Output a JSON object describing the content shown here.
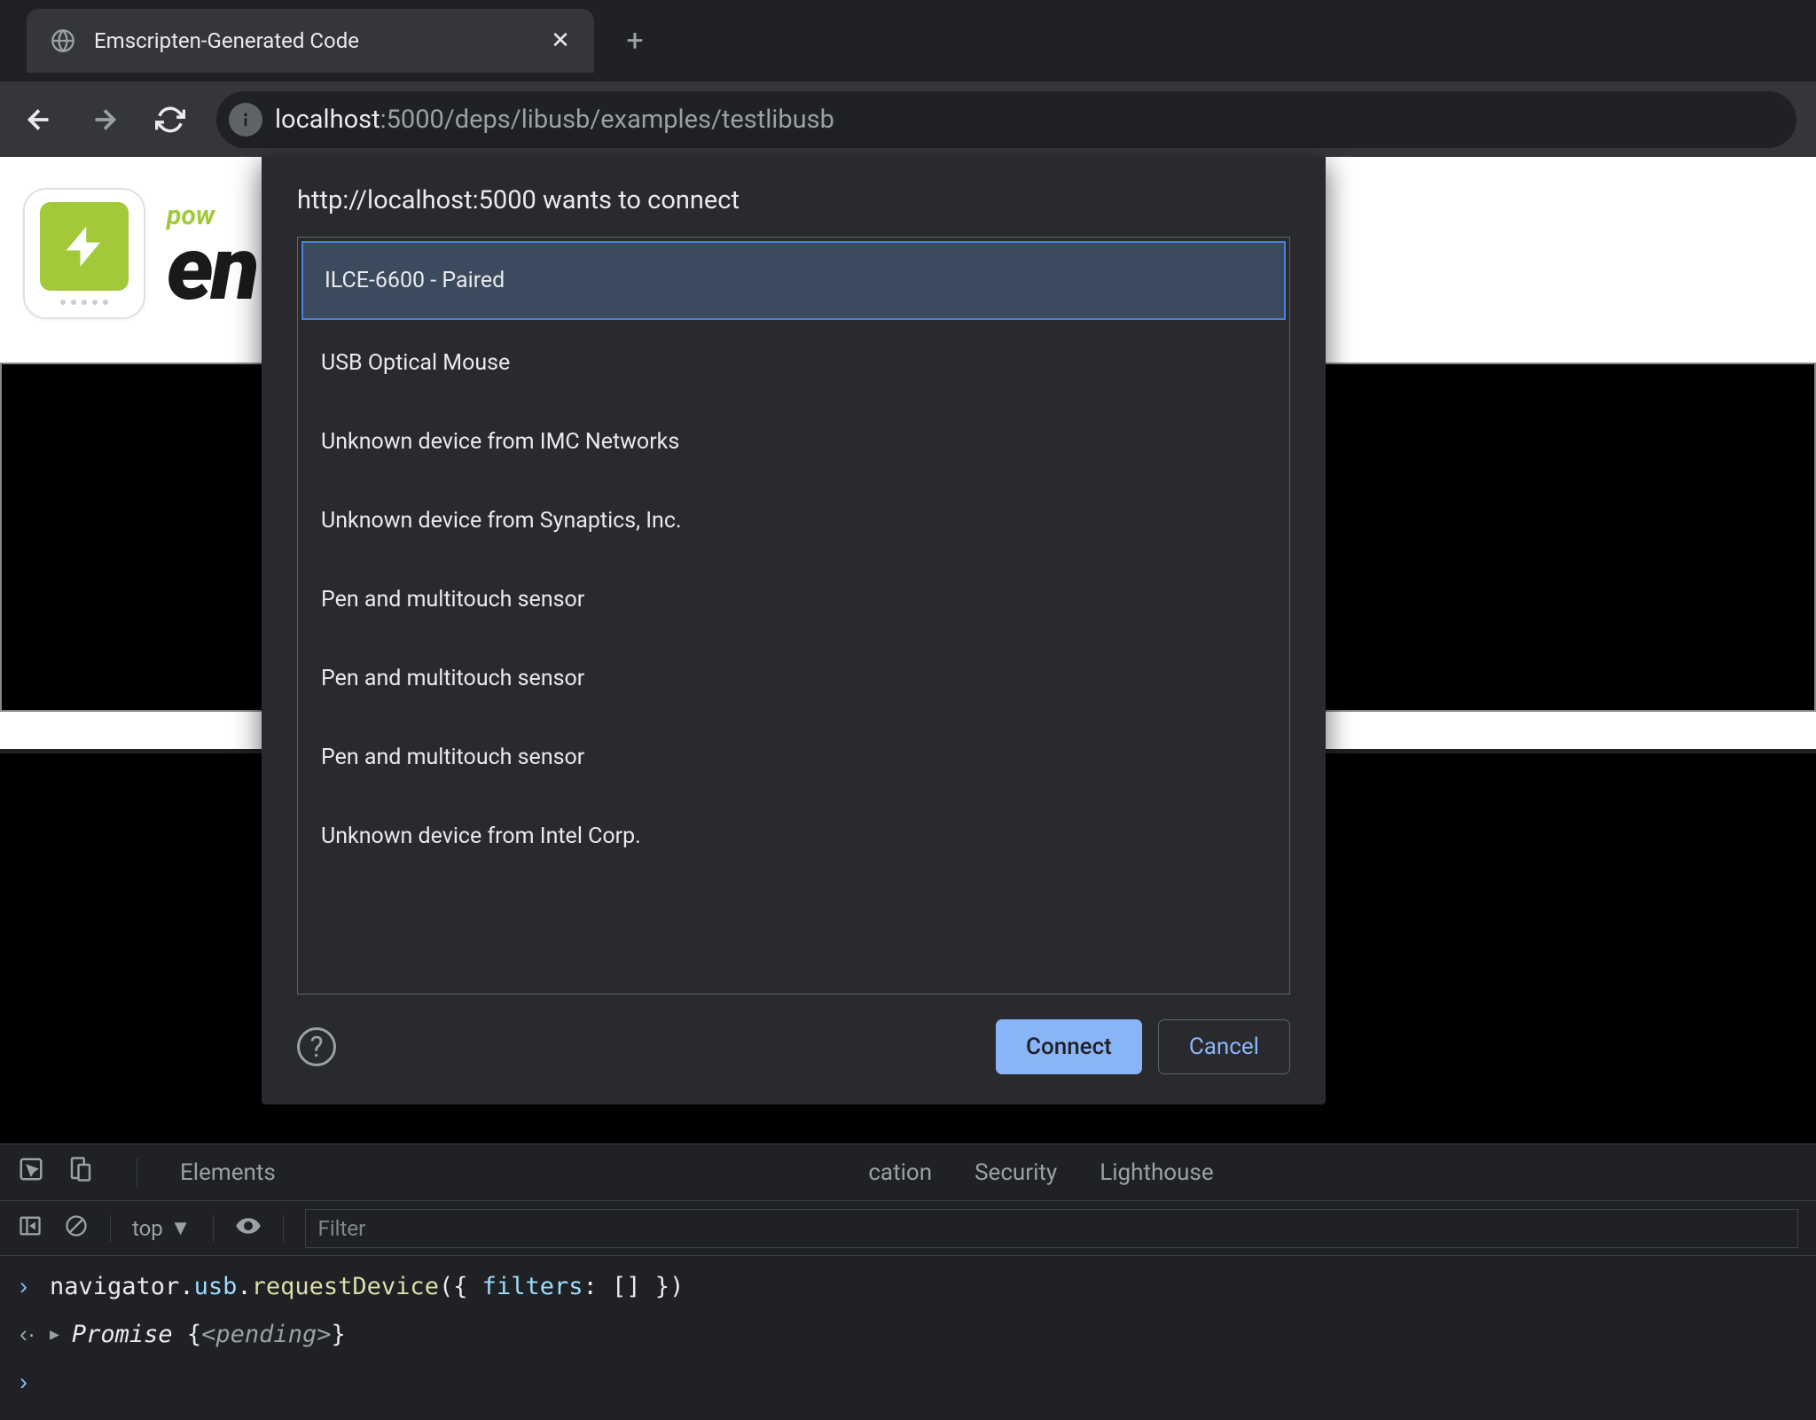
{
  "tab": {
    "title": "Emscripten-Generated Code"
  },
  "url": {
    "host": "localhost",
    "port_path": ":5000/deps/libusb/examples/testlibusb"
  },
  "page": {
    "wordmark_top": "pow",
    "wordmark_main": "en"
  },
  "dialog": {
    "title": "http://localhost:5000 wants to connect",
    "devices": [
      "ILCE-6600 - Paired",
      "USB Optical Mouse",
      "Unknown device from IMC Networks",
      "Unknown device from Synaptics, Inc.",
      "Pen and multitouch sensor",
      "Pen and multitouch sensor",
      "Pen and multitouch sensor",
      "Unknown device from Intel Corp."
    ],
    "connect": "Connect",
    "cancel": "Cancel"
  },
  "devtools": {
    "tabs": {
      "elements": "Elements",
      "console_partial": "",
      "network_partial": "",
      "memory_partial": "",
      "app_suffix": "cation",
      "security": "Security",
      "lighthouse": "Lighthouse"
    },
    "filter": {
      "context": "top",
      "placeholder": "Filter"
    },
    "console": {
      "input": "navigator.usb.requestDevice({ filters: [] })",
      "output_prefix": "Promise ",
      "output_status": "<pending>"
    }
  }
}
